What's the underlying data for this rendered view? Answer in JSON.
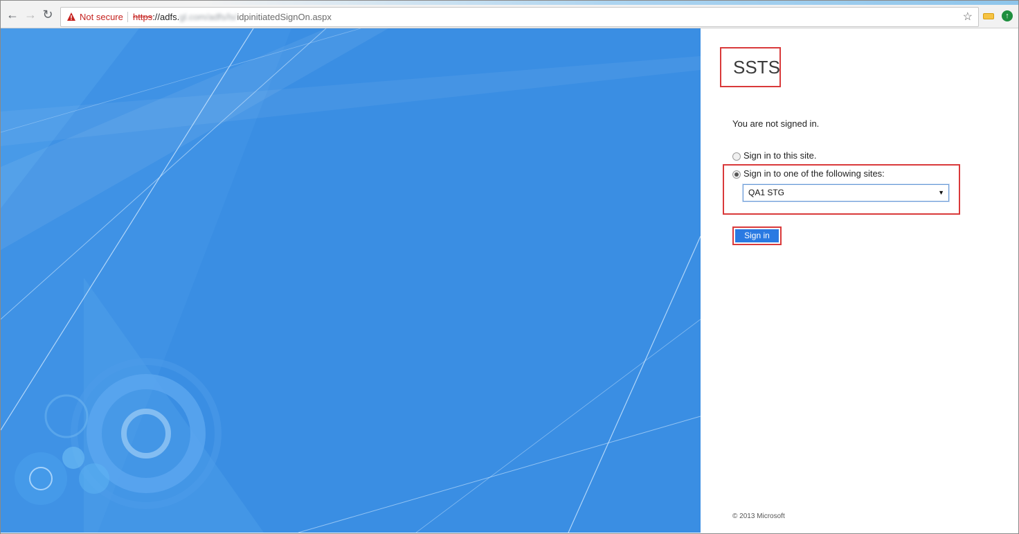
{
  "browser": {
    "security_label": "Not secure",
    "url_scheme": "https",
    "url_host": "://adfs.",
    "url_blurred": "gl.com/adfs/ls/",
    "url_path": "idpinitiatedSignOn.aspx"
  },
  "page": {
    "title": "SSTS",
    "status_text": "You are not signed in.",
    "option_this_site": "Sign in to this site.",
    "option_other_sites": "Sign in to one of the following sites:",
    "selected_site": "QA1 STG",
    "sign_in_label": "Sign in",
    "copyright": "© 2013 Microsoft"
  },
  "colors": {
    "accent": "#2a7ae2",
    "panel_bg": "#3a8ee3",
    "highlight": "#d9393a"
  }
}
